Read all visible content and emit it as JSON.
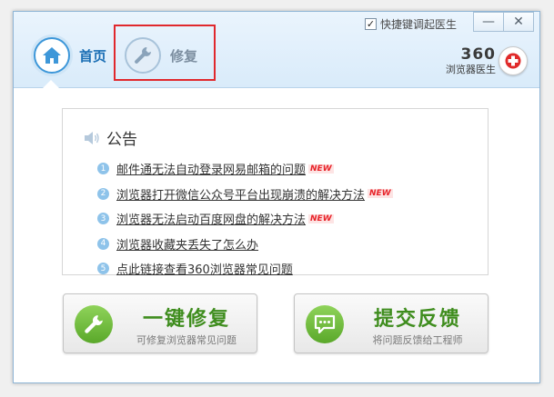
{
  "tabs": [
    {
      "label": "首页"
    },
    {
      "label": "修复"
    }
  ],
  "top_bar": {
    "shortcut_label": "快捷键调起医生",
    "shortcut_checked": true,
    "minimize": "—",
    "close": "✕"
  },
  "brand": {
    "number": "360",
    "subtitle": "浏览器医生"
  },
  "notice": {
    "title": "公告",
    "items": [
      {
        "num": "1",
        "text": "邮件通无法自动登录网易邮箱的问题",
        "badge": "NEW"
      },
      {
        "num": "2",
        "text": "浏览器打开微信公众号平台出现崩溃的解决方法",
        "badge": "NEW"
      },
      {
        "num": "3",
        "text": "浏览器无法启动百度网盘的解决方法",
        "badge": "NEW"
      },
      {
        "num": "4",
        "text": "浏览器收藏夹丢失了怎么办",
        "badge": ""
      },
      {
        "num": "5",
        "text": "点此链接查看360浏览器常见问题",
        "badge": ""
      }
    ]
  },
  "actions": {
    "repair": {
      "title": "一键修复",
      "subtitle": "可修复浏览器常见问题"
    },
    "feedback": {
      "title": "提交反馈",
      "subtitle": "将问题反馈给工程师"
    }
  },
  "colors": {
    "accent": "#3d97d9",
    "green": "#5aa82a",
    "highlight": "#e0282d",
    "new_badge": "#e8242a"
  }
}
